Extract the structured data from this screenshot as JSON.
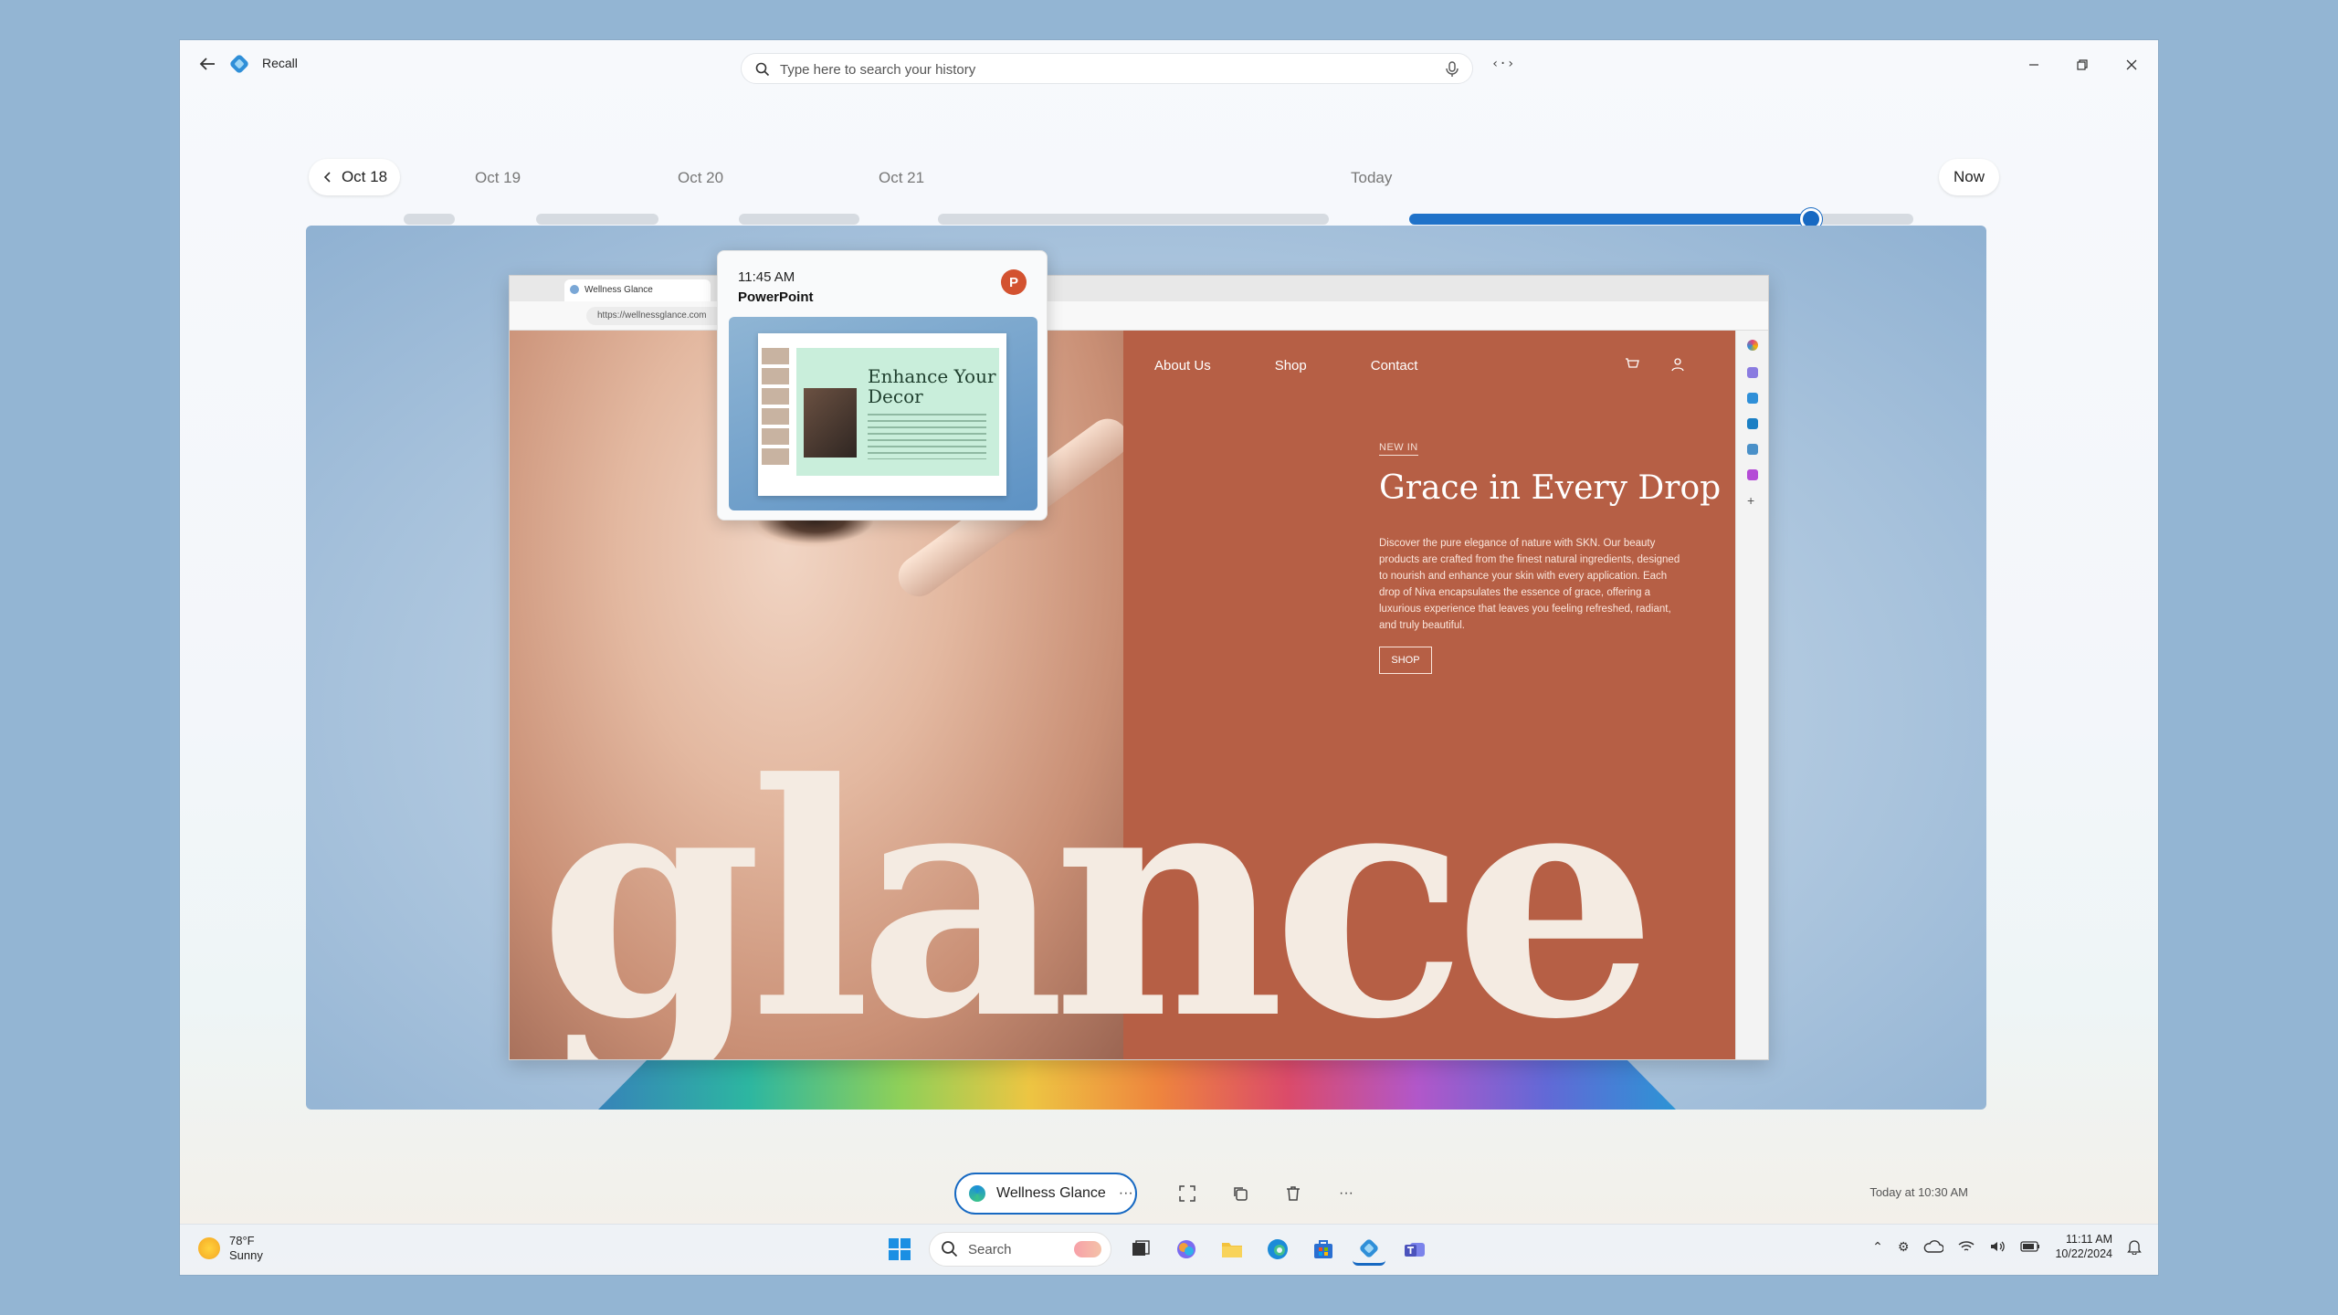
{
  "app": {
    "title": "Recall"
  },
  "search": {
    "placeholder": "Type here to search your history"
  },
  "timeline": {
    "start_label": "Oct 18",
    "dates": [
      "Oct 19",
      "Oct 20",
      "Oct 21",
      "Today"
    ],
    "now_label": "Now"
  },
  "hover_card": {
    "time": "11:45 AM",
    "app": "PowerPoint",
    "slide_title": "Enhance Your Decor"
  },
  "browser": {
    "tab_title": "Wellness Glance",
    "url": "https://wellnessglance.com"
  },
  "website": {
    "nav": [
      "About Us",
      "Shop",
      "Contact"
    ],
    "new_in": "NEW IN",
    "headline": "Grace in Every Drop",
    "body": "Discover the pure elegance of nature with SKN. Our beauty products are crafted from the finest natural ingredients, designed to nourish and enhance your skin with every application. Each drop of Niva encapsulates the essence of grace, offering a luxurious experience that leaves you feeling refreshed, radiant, and truly beautiful.",
    "shop_button": "SHOP",
    "big_word": "glance"
  },
  "bottom": {
    "app_chip": "Wellness Glance",
    "more": "···",
    "timestamp": "Today at 10:30 AM"
  },
  "taskbar": {
    "weather_temp": "78°F",
    "weather_cond": "Sunny",
    "search_label": "Search",
    "time": "11:11 AM",
    "date": "10/22/2024"
  },
  "colors": {
    "accent": "#1769c2",
    "panel": "#b65f45",
    "powerpoint": "#d35230"
  }
}
